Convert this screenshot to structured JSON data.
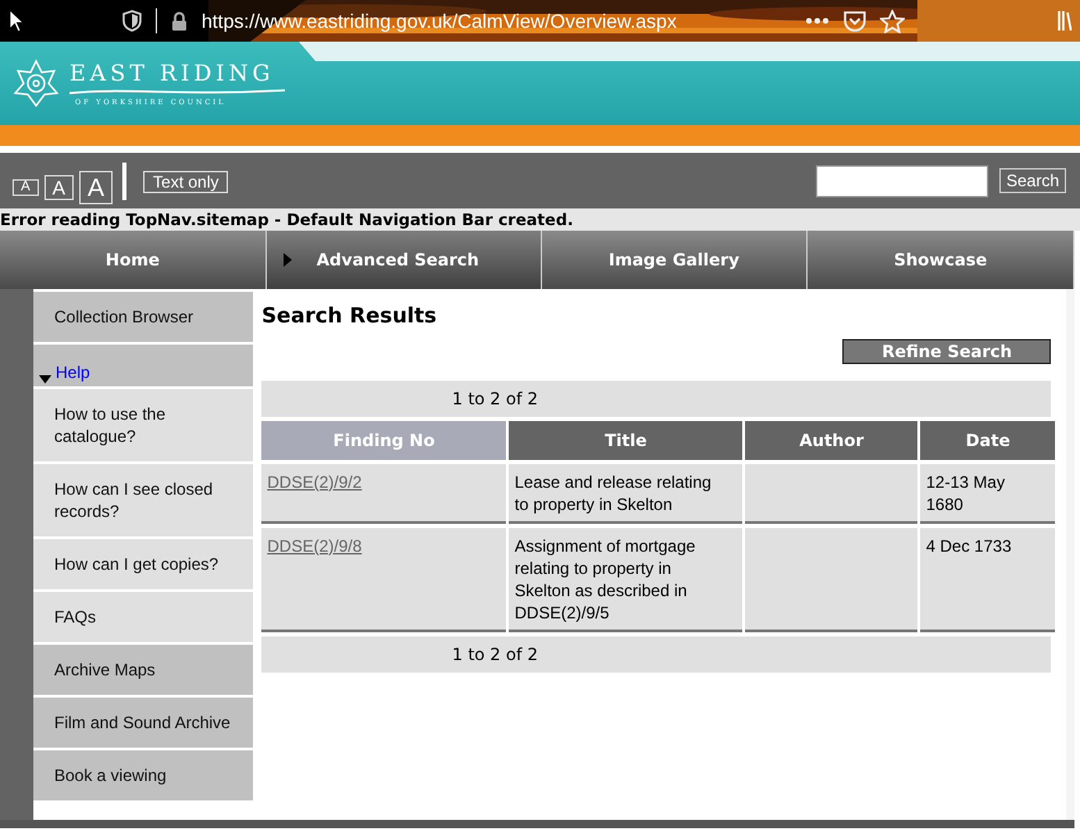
{
  "browser": {
    "url": "https://www.eastriding.gov.uk/CalmView/Overview.aspx"
  },
  "header": {
    "logo_title": "EAST RIDING",
    "logo_subtitle": "OF YORKSHIRE COUNCIL"
  },
  "toolbar": {
    "text_sizes": [
      "A",
      "A",
      "A"
    ],
    "text_only": "Text only",
    "search_button": "Search"
  },
  "error_message": "Error reading TopNav.sitemap - Default Navigation Bar created.",
  "nav": [
    {
      "label": "Home",
      "selected": false
    },
    {
      "label": "Advanced Search",
      "selected": true
    },
    {
      "label": "Image Gallery",
      "selected": false
    },
    {
      "label": "Showcase",
      "selected": false
    }
  ],
  "sidebar": {
    "items": [
      {
        "label": "Collection Browser",
        "kind": "section"
      },
      {
        "label": "Help",
        "kind": "heading",
        "expanded": true,
        "children": [
          {
            "label": "How to use the catalogue?",
            "kind": "item"
          },
          {
            "label": "How can I see closed records?",
            "kind": "item"
          },
          {
            "label": "How can I get copies?",
            "kind": "item"
          },
          {
            "label": "FAQs",
            "kind": "item"
          }
        ]
      },
      {
        "label": "Archive Maps",
        "kind": "section"
      },
      {
        "label": "Film and Sound Archive",
        "kind": "section"
      },
      {
        "label": "Book a viewing",
        "kind": "section"
      }
    ]
  },
  "results": {
    "title": "Search Results",
    "refine_button": "Refine Search",
    "pager_top": "1 to 2 of 2",
    "pager_bottom": "1 to 2 of 2",
    "columns": [
      {
        "label": "Finding No",
        "selected": true
      },
      {
        "label": "Title",
        "selected": false
      },
      {
        "label": "Author",
        "selected": false
      },
      {
        "label": "Date",
        "selected": false
      }
    ],
    "rows": [
      {
        "finding_no": "DDSE(2)/9/2",
        "title": "Lease and release relating to property in Skelton",
        "date": "12-13 May 1680"
      },
      {
        "finding_no": "DDSE(2)/9/8",
        "title": "Assignment of mortgage relating to property in Skelton as described in DDSE(2)/9/5",
        "date": "4 Dec 1733"
      }
    ]
  }
}
